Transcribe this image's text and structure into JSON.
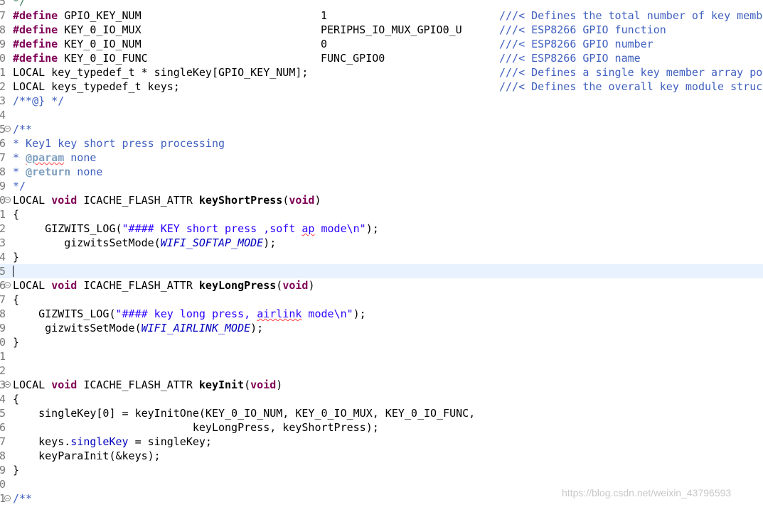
{
  "editor": {
    "lines": [
      {
        "num": "5",
        "fold": false,
        "tokens": [
          {
            "c": "cm",
            "t": "*/"
          }
        ]
      },
      {
        "num": "7",
        "fold": false,
        "tokens": [
          {
            "c": "kw",
            "t": "#define"
          },
          {
            "c": "t",
            "t": " GPIO_KEY_NUM"
          }
        ],
        "value": "1",
        "comment": "///< Defines the total number of key membe"
      },
      {
        "num": "8",
        "fold": false,
        "tokens": [
          {
            "c": "kw",
            "t": "#define"
          },
          {
            "c": "t",
            "t": " KEY_0_IO_MUX"
          }
        ],
        "value": "PERIPHS_IO_MUX_GPIO0_U",
        "comment": "///< ESP8266 GPIO function"
      },
      {
        "num": "9",
        "fold": false,
        "tokens": [
          {
            "c": "kw",
            "t": "#define"
          },
          {
            "c": "t",
            "t": " KEY_0_IO_NUM"
          }
        ],
        "value": "0",
        "comment": "///< ESP8266 GPIO number"
      },
      {
        "num": "0",
        "fold": false,
        "tokens": [
          {
            "c": "kw",
            "t": "#define"
          },
          {
            "c": "t",
            "t": " KEY_0_IO_FUNC"
          }
        ],
        "value": "FUNC_GPIO0",
        "comment": "///< ESP8266 GPIO name"
      },
      {
        "num": "1",
        "fold": false,
        "tokens": [
          {
            "c": "t",
            "t": "LOCAL key_typedef_t * singleKey[GPIO_KEY_NUM];"
          }
        ],
        "comment": "///< Defines a single key member array poi"
      },
      {
        "num": "2",
        "fold": false,
        "tokens": [
          {
            "c": "t",
            "t": "LOCAL keys_typedef_t keys;"
          }
        ],
        "comment": "///< Defines the overall key module struc"
      },
      {
        "num": "3",
        "fold": false,
        "tokens": [
          {
            "c": "cd",
            "t": "/**@} */"
          }
        ]
      },
      {
        "num": "4",
        "fold": false,
        "tokens": []
      },
      {
        "num": "5",
        "fold": true,
        "tokens": [
          {
            "c": "cd",
            "t": "/**"
          }
        ]
      },
      {
        "num": "6",
        "fold": false,
        "tokens": [
          {
            "c": "cd",
            "t": "* Key1 key short press processing"
          }
        ]
      },
      {
        "num": "7",
        "fold": false,
        "tokens": [
          {
            "c": "cd",
            "t": "* "
          },
          {
            "c": "tag",
            "t": "@param",
            "sp": true
          },
          {
            "c": "cd",
            "t": " none"
          }
        ]
      },
      {
        "num": "8",
        "fold": false,
        "tokens": [
          {
            "c": "cd",
            "t": "* "
          },
          {
            "c": "tag",
            "t": "@return"
          },
          {
            "c": "cd",
            "t": " none"
          }
        ]
      },
      {
        "num": "9",
        "fold": false,
        "tokens": [
          {
            "c": "cd",
            "t": "*/"
          }
        ]
      },
      {
        "num": "0",
        "fold": true,
        "tokens": [
          {
            "c": "t",
            "t": "LOCAL "
          },
          {
            "c": "kw",
            "t": "void"
          },
          {
            "c": "t",
            "t": " ICACHE_FLASH_ATTR "
          },
          {
            "c": "fn",
            "t": "keyShortPress"
          },
          {
            "c": "t",
            "t": "("
          },
          {
            "c": "kw",
            "t": "void"
          },
          {
            "c": "t",
            "t": ")"
          }
        ]
      },
      {
        "num": "1",
        "fold": false,
        "tokens": [
          {
            "c": "t",
            "t": "{"
          }
        ]
      },
      {
        "num": "2",
        "fold": false,
        "tokens": [
          {
            "c": "t",
            "t": "     GIZWITS_LOG("
          },
          {
            "c": "str",
            "t": "\"#### KEY short press ,soft "
          },
          {
            "c": "str",
            "t": "ap",
            "sp": true
          },
          {
            "c": "str",
            "t": " mode\\n\""
          },
          {
            "c": "t",
            "t": ");"
          }
        ]
      },
      {
        "num": "3",
        "fold": false,
        "tokens": [
          {
            "c": "t",
            "t": "        gizwitsSetMode("
          },
          {
            "c": "en",
            "t": "WIFI_SOFTAP_MODE"
          },
          {
            "c": "t",
            "t": ");"
          }
        ]
      },
      {
        "num": "4",
        "fold": false,
        "tokens": [
          {
            "c": "t",
            "t": "}"
          }
        ]
      },
      {
        "num": "5",
        "fold": false,
        "current": true,
        "tokens": []
      },
      {
        "num": "6",
        "fold": true,
        "tokens": [
          {
            "c": "t",
            "t": "LOCAL "
          },
          {
            "c": "kw",
            "t": "void"
          },
          {
            "c": "t",
            "t": " ICACHE_FLASH_ATTR "
          },
          {
            "c": "fn",
            "t": "keyLongPress"
          },
          {
            "c": "t",
            "t": "("
          },
          {
            "c": "kw",
            "t": "void"
          },
          {
            "c": "t",
            "t": ")"
          }
        ]
      },
      {
        "num": "7",
        "fold": false,
        "tokens": [
          {
            "c": "t",
            "t": "{"
          }
        ]
      },
      {
        "num": "8",
        "fold": false,
        "tokens": [
          {
            "c": "t",
            "t": "    GIZWITS_LOG("
          },
          {
            "c": "str",
            "t": "\"#### key long press, "
          },
          {
            "c": "str",
            "t": "airlink",
            "sp": true
          },
          {
            "c": "str",
            "t": " mode\\n\""
          },
          {
            "c": "t",
            "t": ");"
          }
        ]
      },
      {
        "num": "9",
        "fold": false,
        "tokens": [
          {
            "c": "t",
            "t": "     gizwitsSetMode("
          },
          {
            "c": "en",
            "t": "WIFI_AIRLINK_MODE"
          },
          {
            "c": "t",
            "t": ");"
          }
        ]
      },
      {
        "num": "0",
        "fold": false,
        "tokens": [
          {
            "c": "t",
            "t": "}"
          }
        ]
      },
      {
        "num": "1",
        "fold": false,
        "tokens": []
      },
      {
        "num": "2",
        "fold": false,
        "tokens": []
      },
      {
        "num": "3",
        "fold": true,
        "tokens": [
          {
            "c": "t",
            "t": "LOCAL "
          },
          {
            "c": "kw",
            "t": "void"
          },
          {
            "c": "t",
            "t": " ICACHE_FLASH_ATTR "
          },
          {
            "c": "fn",
            "t": "keyInit"
          },
          {
            "c": "t",
            "t": "("
          },
          {
            "c": "kw",
            "t": "void"
          },
          {
            "c": "t",
            "t": ")"
          }
        ]
      },
      {
        "num": "4",
        "fold": false,
        "tokens": [
          {
            "c": "t",
            "t": "{"
          }
        ]
      },
      {
        "num": "5",
        "fold": false,
        "tokens": [
          {
            "c": "t",
            "t": "    singleKey[0] = keyInitOne(KEY_0_IO_NUM, KEY_0_IO_MUX, KEY_0_IO_FUNC,"
          }
        ]
      },
      {
        "num": "6",
        "fold": false,
        "tokens": [
          {
            "c": "t",
            "t": "                            keyLongPress, keyShortPress);"
          }
        ]
      },
      {
        "num": "7",
        "fold": false,
        "tokens": [
          {
            "c": "t",
            "t": "    keys."
          },
          {
            "c": "fld",
            "t": "singleKey"
          },
          {
            "c": "t",
            "t": " = singleKey;"
          }
        ]
      },
      {
        "num": "8",
        "fold": false,
        "tokens": [
          {
            "c": "t",
            "t": "    keyParaInit(&keys);"
          }
        ]
      },
      {
        "num": "9",
        "fold": false,
        "tokens": [
          {
            "c": "t",
            "t": "}"
          }
        ]
      },
      {
        "num": "0",
        "fold": false,
        "tokens": []
      },
      {
        "num": "1",
        "fold": true,
        "tokens": [
          {
            "c": "cd",
            "t": "/**"
          }
        ]
      }
    ]
  },
  "watermark": "https://blog.csdn.net/weixin_43796593"
}
